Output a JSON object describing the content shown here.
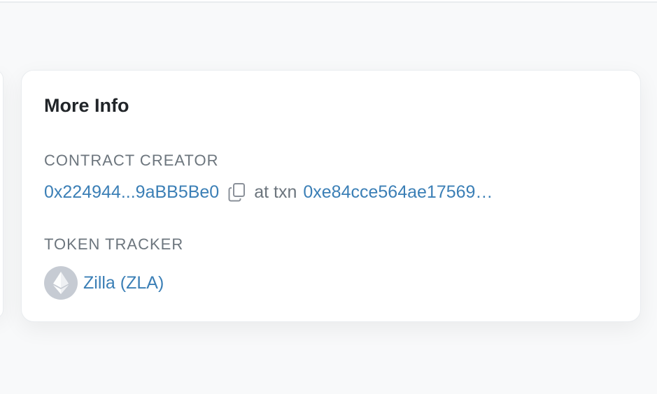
{
  "card": {
    "title": "More Info"
  },
  "contract_creator": {
    "label": "CONTRACT CREATOR",
    "address": "0x224944...9aBB5Be0",
    "connector": "at txn",
    "txn_hash": "0xe84cce564ae17569…",
    "copy_icon": "copy-icon"
  },
  "token_tracker": {
    "label": "TOKEN TRACKER",
    "token_name": "Zilla (ZLA)",
    "logo_icon": "ethereum-icon"
  },
  "colors": {
    "link": "#3b7fb6",
    "muted": "#6c757d",
    "title": "#212529",
    "card_bg": "#ffffff",
    "page_bg": "#f8f9fa"
  }
}
